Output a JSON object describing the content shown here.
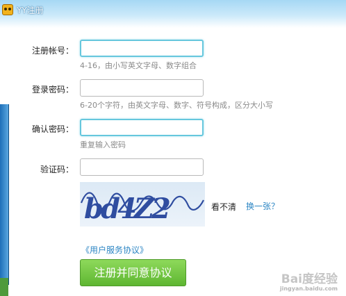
{
  "window": {
    "title": "YY注册"
  },
  "form": {
    "account": {
      "label": "注册帐号：",
      "value": "",
      "hint": "4-16，由小写英文字母、数字组合"
    },
    "password": {
      "label": "登录密码：",
      "value": "",
      "hint": "6-20个字符，由英文字母、数字、符号构成，区分大小写"
    },
    "confirm": {
      "label": "确认密码：",
      "value": "",
      "hint": "重复输入密码"
    },
    "captcha": {
      "label": "验证码：",
      "value": "",
      "image_text": "bd4Z2",
      "cant_see_text": "看不清",
      "change_link": "换一张？"
    },
    "agreement_link": "《用户服务协议》",
    "submit_label": "注册并同意协议"
  },
  "colors": {
    "title_bar_gradient": [
      "#a6d8f4",
      "#ffffff"
    ],
    "focus_border": "#66c7dd",
    "link": "#2c86c4",
    "button_green": "#6cc43c",
    "hint_gray": "#8a8a8a"
  },
  "watermark": {
    "main": "Bai度经验",
    "sub": "jingyan.baidu.com"
  }
}
